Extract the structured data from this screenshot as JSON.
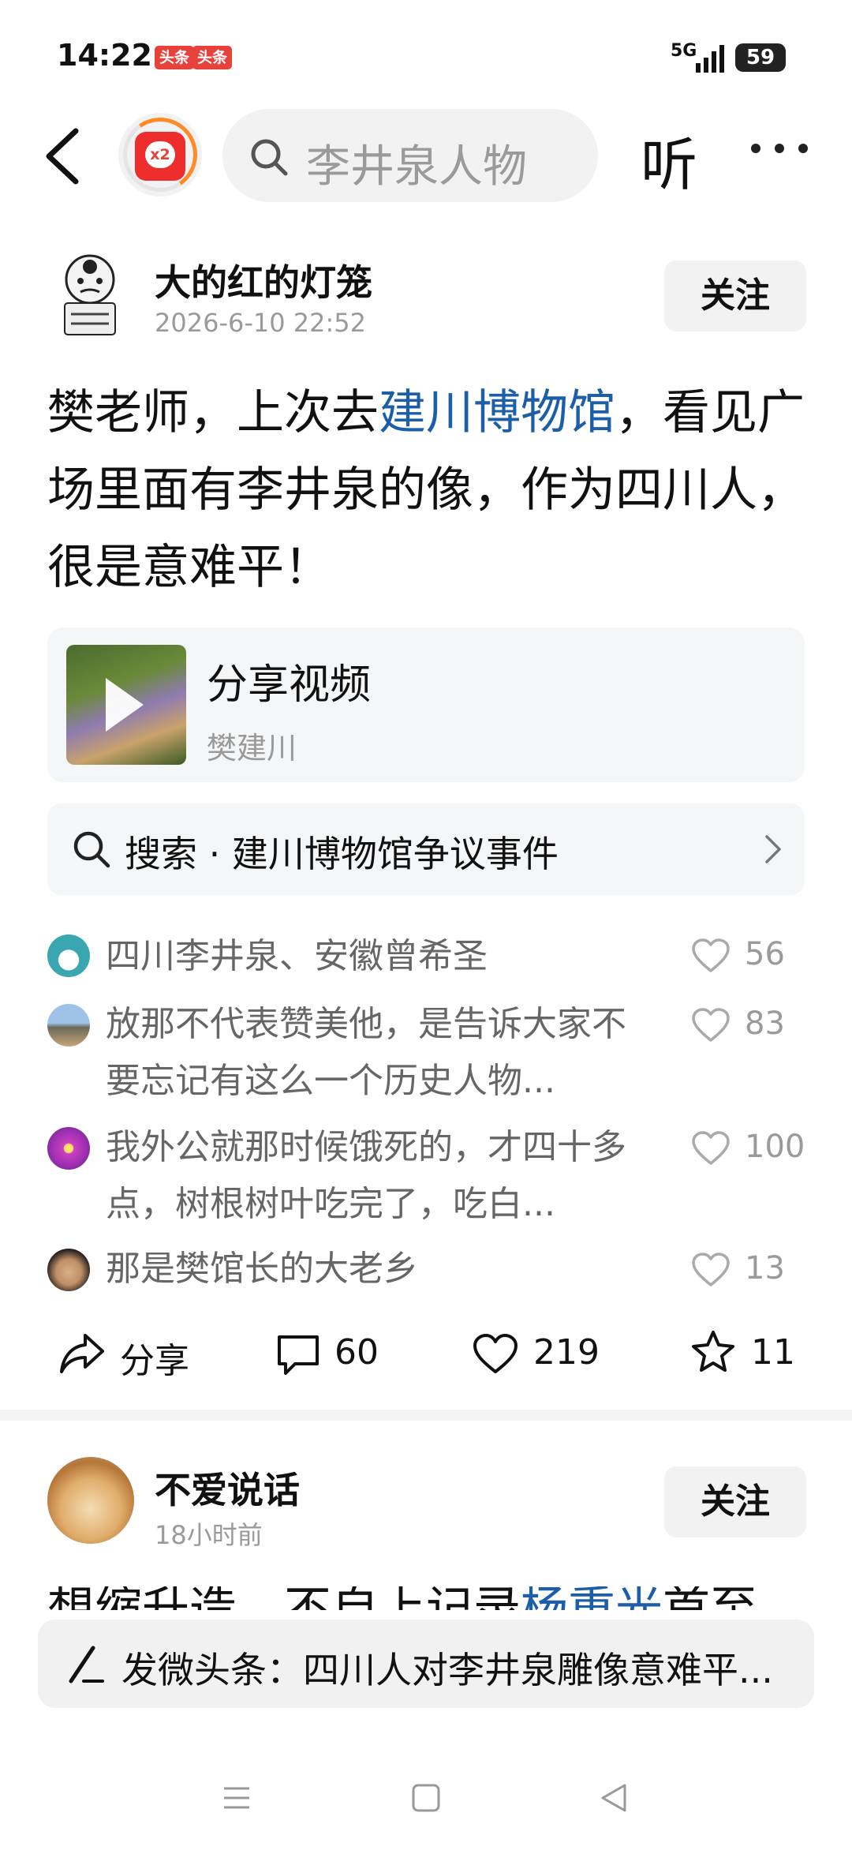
{
  "status_bar": {
    "time": "14:22",
    "badges": [
      "头条",
      "头条"
    ],
    "network": "5G",
    "battery": "59"
  },
  "nav": {
    "redpacket_label": "x2",
    "search_text": "李井泉人物",
    "listen_label": "听"
  },
  "post1": {
    "author": "大的红的灯笼",
    "time": "2026-6-10 22:52",
    "follow_label": "关注",
    "text_before_link": "樊老师，上次去",
    "link_text": "建川博物馆",
    "text_after_link": "，看见广场里面有李井泉的像，作为四川人，很是意难平！",
    "shared_video": {
      "title": "分享视频",
      "author": "樊建川"
    },
    "related_search": "搜索 · 建川博物馆争议事件",
    "comments": [
      {
        "text": "四川李井泉、安徽曾希圣",
        "likes": "56"
      },
      {
        "text": "放那不代表赞美他，是告诉大家不要忘记有这么一个历史人物...",
        "likes": "83"
      },
      {
        "text": "我外公就那时候饿死的，才四十多点，树根树叶吃完了，吃白...",
        "likes": "100"
      },
      {
        "text": "那是樊馆长的大老乡",
        "likes": "13"
      }
    ],
    "actions": {
      "share": "分享",
      "comments": "60",
      "likes": "219",
      "favorites": "11"
    }
  },
  "post2": {
    "author": "不爱说话",
    "time": "18小时前",
    "follow_label": "关注",
    "text_partial_before": "想缩升造，不自上记录",
    "text_partial_link": "杨重光",
    "text_partial_after": "首至"
  },
  "compose": {
    "text": "发微头条：四川人对李井泉雕像意难平..."
  },
  "colors": {
    "accent_red": "#e8413a",
    "link_blue": "#1d5ea8",
    "progress_orange": "#ff8a26"
  }
}
